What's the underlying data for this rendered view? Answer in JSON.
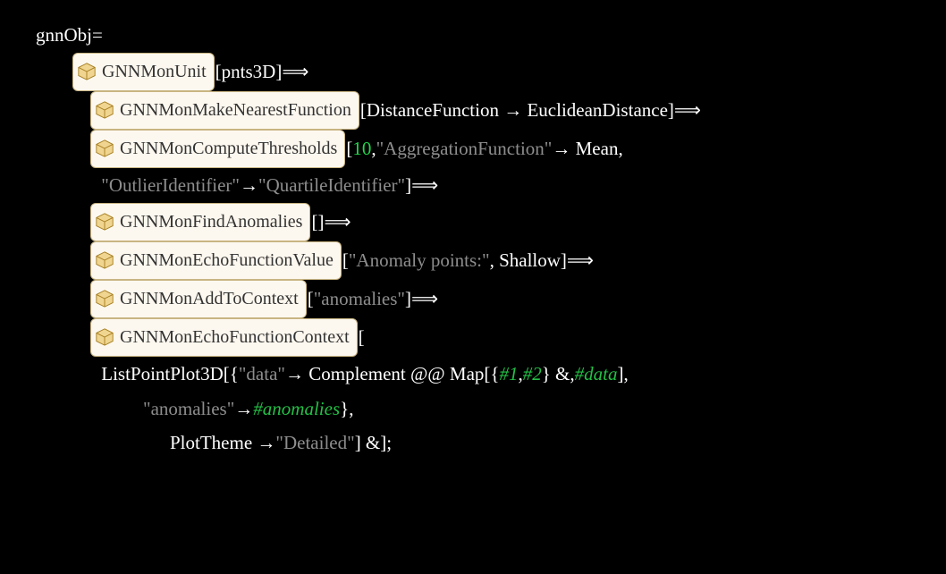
{
  "code": {
    "line1a": "gnnObj",
    "line1b": " =",
    "fn1": "GNNMonUnit",
    "fn1arg": "[pnts3D]⟹",
    "fn2": "GNNMonMakeNearestFunction",
    "fn2arg1": "[DistanceFunction → EuclideanDistance]⟹",
    "fn3": "GNNMonComputeThresholds",
    "fn3arg_n": "10",
    "fn3arg_pre": "[",
    "fn3arg_post": ", ",
    "fn3arg_key": "\"AggregationFunction\"",
    "fn3arg_tail": " → Mean,",
    "fn3b_key": "\"OutlierIdentifier\"",
    "fn3b_mid": " → ",
    "fn3b_val": "\"QuartileIdentifier\"",
    "fn3b_tail": "]⟹",
    "fn4": "GNNMonFindAnomalies",
    "fn4arg": "[]⟹",
    "fn5": "GNNMonEchoFunctionValue",
    "fn5_pre": "[",
    "fn5_str": "\"Anomaly points:\"",
    "fn5_tail": ", Shallow]⟹",
    "fn6": "GNNMonAddToContext",
    "fn6_pre": "[",
    "fn6_str": "\"anomalies\"",
    "fn6_tail": "]⟹",
    "fn7": "GNNMonEchoFunctionContext",
    "fn7_tail": "[",
    "l8a": "ListPointPlot3D[{",
    "l8a_str": "\"data\"",
    "l8a_mid": " → Complement @@ Map[{",
    "l8a_s1": "#1",
    "l8a_c1": ", ",
    "l8a_s2": "#2",
    "l8a_c2": "} &, ",
    "l8a_s3": "#data",
    "l8a_c3": "],",
    "l9_key": "\"anomalies\"",
    "l9_mid": " → ",
    "l9_slot": "#anomalies",
    "l9_tail": "},",
    "l10a": "PlotTheme → ",
    "l10_str": "\"Detailed\"",
    "l10_tail": "] &];"
  }
}
